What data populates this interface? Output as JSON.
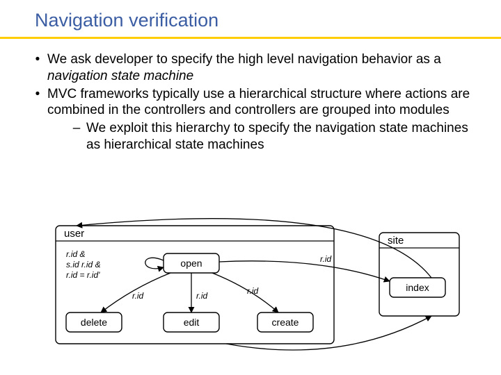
{
  "title": "Navigation verification",
  "bullets": {
    "b1_pre": "We ask developer to specify the high level navigation behavior as a ",
    "b1_em": "navigation state machine",
    "b2": "MVC frameworks typically use a hierarchical structure where actions are combined in the controllers and controllers are grouped into modules",
    "b2_sub": "We exploit this hierarchy to specify the navigation state machines as hierarchical state machines"
  },
  "diagram": {
    "user_label": "user",
    "site_label": "site",
    "nodes": {
      "open": "open",
      "delete": "delete",
      "edit": "edit",
      "create": "create",
      "index": "index"
    },
    "edge_labels": {
      "rid": "r.id",
      "guard_line1": "r.id    &",
      "guard_line2": "s.id    r.id &",
      "guard_line3": "r.id = r.id'"
    }
  }
}
